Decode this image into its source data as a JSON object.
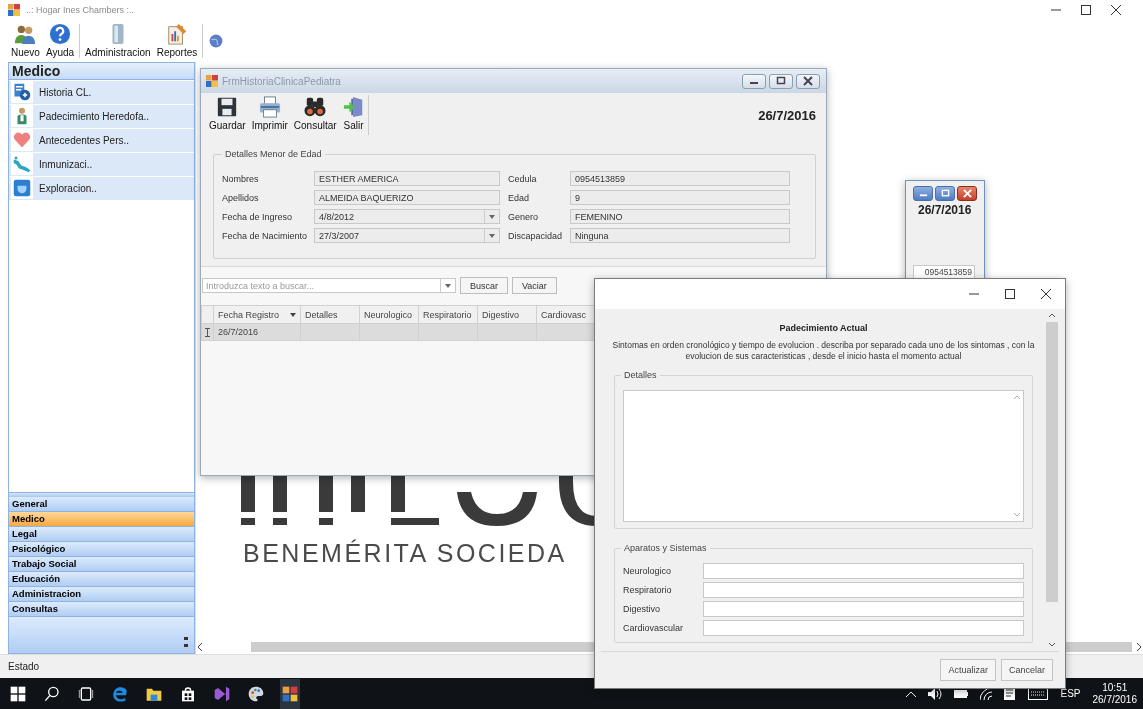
{
  "main_window": {
    "title": "..: Hogar Ines Chambers :..",
    "toolbar": [
      {
        "label": "Nuevo",
        "kind": "people"
      },
      {
        "label": "Ayuda",
        "kind": "help"
      },
      {
        "label": "Administracion",
        "kind": "server"
      },
      {
        "label": "Reportes",
        "kind": "report"
      }
    ]
  },
  "sidebar": {
    "header": "Medico",
    "items": [
      {
        "label": "Historia CL.",
        "kind": "record"
      },
      {
        "label": "Padecimiento Heredofa..",
        "kind": "person"
      },
      {
        "label": "Antecedentes Pers..",
        "kind": "heart"
      },
      {
        "label": "Inmunizaci..",
        "kind": "vaccine"
      },
      {
        "label": "Exploracion..",
        "kind": "exam"
      }
    ],
    "sections": [
      {
        "label": "General",
        "selected": false
      },
      {
        "label": "Medico",
        "selected": true
      },
      {
        "label": "Legal",
        "selected": false
      },
      {
        "label": "Psicológico",
        "selected": false
      },
      {
        "label": "Trabajo Social",
        "selected": false
      },
      {
        "label": "Educación",
        "selected": false
      },
      {
        "label": "Administracion",
        "selected": false
      },
      {
        "label": "Consultas",
        "selected": false
      }
    ]
  },
  "background_logo": {
    "subtitle": "BENEMÉRITA SOCIEDA"
  },
  "form_window": {
    "title": "FrmHistoriaClinicaPediatra",
    "toolbar": [
      {
        "label": "Guardar",
        "kind": "save"
      },
      {
        "label": "Imprimir",
        "kind": "print"
      },
      {
        "label": "Consultar",
        "kind": "binoculars"
      },
      {
        "label": "Salir",
        "kind": "exit"
      }
    ],
    "date": "26/7/2016",
    "group": {
      "title": "Detalles Menor de Edad",
      "fields": [
        {
          "label": "Nombres",
          "value": "ESTHER AMERICA",
          "kind": "text"
        },
        {
          "label": "Cedula",
          "value": "0954513859",
          "kind": "number"
        },
        {
          "label": "Apellidos",
          "value": "ALMEIDA  BAQUERIZO",
          "kind": "text"
        },
        {
          "label": "Edad",
          "value": "9",
          "kind": "number"
        },
        {
          "label": "Fecha de Ingreso",
          "value": "4/8/2012",
          "kind": "date"
        },
        {
          "label": "Genero",
          "value": "FEMENINO",
          "kind": "text"
        },
        {
          "label": "Fecha de Nacimiento",
          "value": "27/3/2007",
          "kind": "date"
        },
        {
          "label": "Discapacidad",
          "value": "Ninguna",
          "kind": "text"
        }
      ]
    },
    "search": {
      "placeholder": "Introduzca texto a buscar...",
      "buttons": [
        "Buscar",
        "Vaciar"
      ]
    },
    "grid": {
      "columns": [
        {
          "label": "Fecha Registro",
          "sorted": true
        },
        {
          "label": "Detalles",
          "sorted": false
        },
        {
          "label": "Neurologico",
          "sorted": false
        },
        {
          "label": "Respiratorio",
          "sorted": false
        },
        {
          "label": "Digestivo",
          "sorted": false
        },
        {
          "label": "Cardiovasc",
          "sorted": false
        }
      ],
      "rows": [
        {
          "cells": [
            "26/7/2016"
          ],
          "selected": true
        }
      ]
    }
  },
  "background_window": {
    "date": "26/7/2016",
    "cedula": "0954513859"
  },
  "dialog": {
    "heading": "Padecimiento Actual",
    "description": "Sintomas en orden cronológico y tiempo de evolucion . describa por separado cada uno de los sintomas , con la evolucion de sus caracteristicas , desde el inicio hasta el momento actual",
    "details_group": {
      "title": "Detalles"
    },
    "systems_group": {
      "title": "Aparatos y Sistemas",
      "fields": [
        {
          "label": "Neurologico"
        },
        {
          "label": "Respiratorio"
        },
        {
          "label": "Digestivo"
        },
        {
          "label": "Cardiovascular"
        }
      ]
    },
    "buttons": [
      "Actualizar",
      "Cancelar"
    ]
  },
  "status_bar": {
    "text": "Estado"
  },
  "taskbar": {
    "language": "ESP",
    "time": "10:51",
    "date": "26/7/2016"
  }
}
